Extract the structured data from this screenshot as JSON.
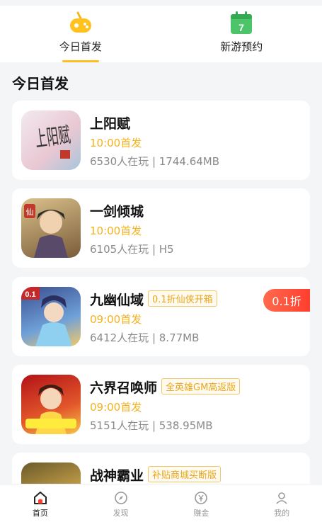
{
  "tabs": [
    {
      "label": "今日首发",
      "icon": "gamepad-icon",
      "active": true
    },
    {
      "label": "新游预约",
      "icon": "calendar-icon",
      "calendar_day": "7",
      "active": false
    }
  ],
  "section": {
    "title": "今日首发"
  },
  "games": [
    {
      "name": "上阳赋",
      "tag": "",
      "time": "10:00首发",
      "meta": "6530人在玩 | 1744.64MB"
    },
    {
      "name": "一剑倾城",
      "tag": "",
      "time": "10:00首发",
      "meta": "6105人在玩 | H5"
    },
    {
      "name": "九幽仙域",
      "tag": "0.1折仙侠开箱",
      "time": "09:00首发",
      "meta": "6412人在玩 | 8.77MB",
      "badge": "0.1折",
      "icon_text": "0.1"
    },
    {
      "name": "六界召唤师",
      "tag": "全英雄GM高返版",
      "time": "09:00首发",
      "meta": "5151人在玩 | 538.95MB"
    },
    {
      "name": "战神霸业",
      "tag": "补贴商城买断版",
      "time": "",
      "meta": ""
    }
  ],
  "icon_art": {
    "game1_logo": "上阳赋",
    "game2_seal": "仙"
  },
  "nav": [
    {
      "label": "首页",
      "icon": "home-icon",
      "active": true
    },
    {
      "label": "发现",
      "icon": "compass-icon",
      "active": false
    },
    {
      "label": "赚金",
      "icon": "yen-coin-icon",
      "active": false
    },
    {
      "label": "我的",
      "icon": "user-icon",
      "active": false
    }
  ],
  "colors": {
    "accent": "#ffbf1a",
    "time": "#f5b21b",
    "badge": "#ff3f2e",
    "background": "#f4f5f7"
  }
}
